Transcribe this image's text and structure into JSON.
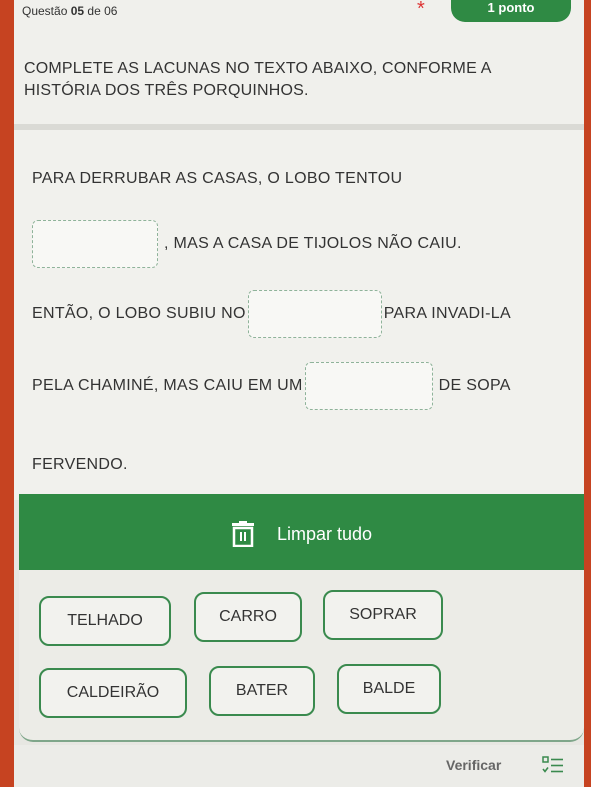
{
  "header": {
    "question_prefix": "Questão ",
    "question_number": "05",
    "question_suffix": " de 06",
    "required_mark": "*",
    "points": "1 ponto"
  },
  "instruction": "COMPLETE AS LACUNAS NO TEXTO ABAIXO, CONFORME A HISTÓRIA DOS TRÊS PORQUINHOS.",
  "passage": {
    "line1": "PARA DERRUBAR AS CASAS, O LOBO TENTOU",
    "line2_after": ", MAS A CASA DE TIJOLOS NÃO CAIU.",
    "line3_before": "ENTÃO, O LOBO SUBIU NO",
    "line3_after": "PARA INVADI-LA",
    "line4_before": "PELA CHAMINÉ, MAS CAIU EM UM",
    "line4_after": "DE SOPA",
    "line5": "FERVENDO."
  },
  "clear_all": {
    "label": "Limpar tudo",
    "icon": "trash-icon"
  },
  "words": [
    "TELHADO",
    "CARRO",
    "SOPRAR",
    "CALDEIRÃO",
    "BATER",
    "BALDE"
  ],
  "footer": {
    "verify_label": "Verificar",
    "icon": "checklist-icon"
  },
  "colors": {
    "accent": "#2f8a44",
    "background_frame": "#c64321",
    "required": "#dd3333"
  }
}
